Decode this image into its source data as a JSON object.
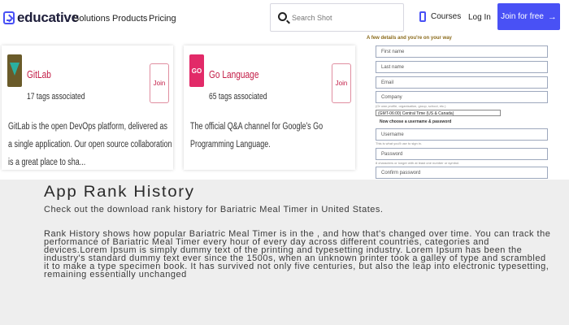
{
  "nav": {
    "logo": "educative",
    "links": [
      "Solutions",
      "Products",
      "Pricing"
    ],
    "search_placeholder": "Search Shot",
    "courses": "Courses",
    "login": "Log In",
    "join": "Join for free",
    "accent_color": "#4951f5"
  },
  "cards": [
    {
      "title": "GitLab",
      "tags": "17 tags associated",
      "join": "Join",
      "description": "GitLab is the open DevOps platform, delivered as a single application. Our open source collaboration is a great place to sha..."
    },
    {
      "title": "Go Language",
      "tags": "65 tags associated",
      "join": "Join",
      "logo_text": "GO",
      "description": "The official Q&A channel for Google's Go Programming Language."
    }
  ],
  "form": {
    "header": "A few details and you're on your way",
    "first_name": "First name",
    "last_name": "Last name",
    "email": "Email",
    "company": "Company",
    "company_help": "(Or own profile, organisation, group, school, etc.)",
    "timezone": "(GMT-06:00) Central Time (US & Canada)",
    "subhead": "Now choose a username & password",
    "username": "Username",
    "username_help": "This is what you'll use to sign in.",
    "password": "Password",
    "password_help": "8 characters or longer with at least one number or symbol.",
    "confirm_password": "Confirm password"
  },
  "rank": {
    "title": "App Rank History",
    "intro": "Check out the download rank history for Bariatric Meal Timer in United States.",
    "body": "Rank History shows how popular Bariatric Meal Timer is in the , and how that's changed over time. You can track the performance of Bariatric Meal Timer every hour of every day across different countries, categories and devices.Lorem Ipsum is simply dummy text of the printing and typesetting industry. Lorem Ipsum has been the industry's standard dummy text ever since the 1500s, when an unknown printer took a galley of type and scrambled it to make a type specimen book. It has survived not only five centuries, but also the leap into electronic typesetting, remaining essentially unchanged"
  }
}
